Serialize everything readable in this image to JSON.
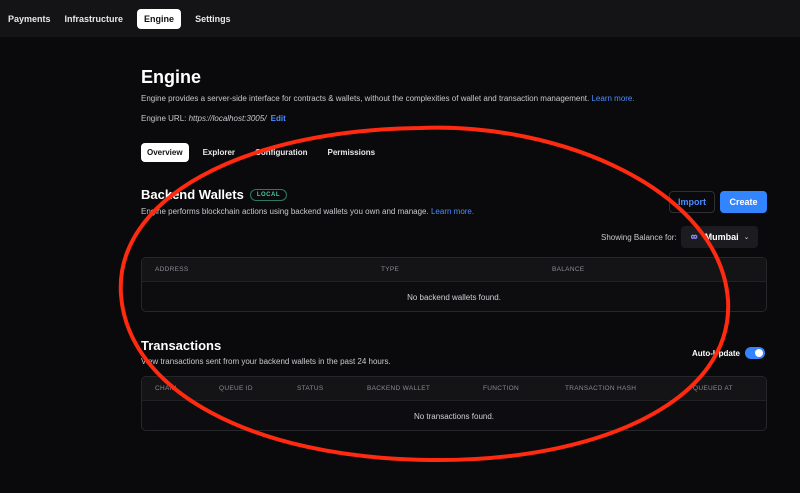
{
  "topnav": {
    "items": [
      "Payments",
      "Infrastructure",
      "Engine",
      "Settings"
    ],
    "active": "Engine"
  },
  "page": {
    "title": "Engine",
    "description": "Engine provides a server-side interface for contracts & wallets, without the complexities of wallet and transaction management.",
    "learn_more": "Learn more.",
    "url_label": "Engine URL:",
    "url_value": "https://localhost:3005/",
    "edit_label": "Edit"
  },
  "tabs": [
    "Overview",
    "Explorer",
    "Configuration",
    "Permissions"
  ],
  "backend_wallets": {
    "title": "Backend Wallets",
    "badge": "LOCAL",
    "description": "Engine performs blockchain actions using backend wallets you own and manage.",
    "learn_more": "Learn more.",
    "import_label": "Import",
    "create_label": "Create",
    "balance_label": "Showing Balance for:",
    "chain": "Mumbai",
    "columns": [
      "ADDRESS",
      "TYPE",
      "BALANCE"
    ],
    "empty": "No backend wallets found."
  },
  "transactions": {
    "title": "Transactions",
    "description": "View transactions sent from your backend wallets in the past 24 hours.",
    "auto_update_label": "Auto-Update",
    "auto_update_on": true,
    "columns": [
      "CHAIN",
      "QUEUE ID",
      "STATUS",
      "BACKEND WALLET",
      "FUNCTION",
      "TRANSACTION HASH",
      "QUEUED AT"
    ],
    "empty": "No transactions found."
  },
  "colors": {
    "accent": "#3385ff",
    "annotation": "#ff2a10"
  }
}
